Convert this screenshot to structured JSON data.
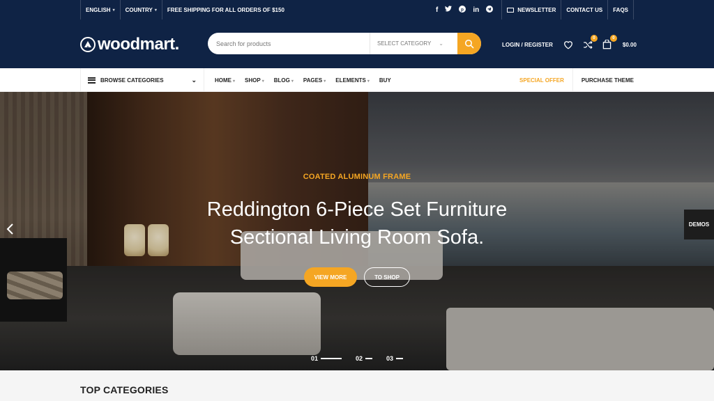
{
  "topbar": {
    "language": "ENGLISH",
    "country": "COUNTRY",
    "shipping": "FREE SHIPPING FOR ALL ORDERS OF $150",
    "socials": [
      "f",
      "t",
      "p",
      "in",
      "tg"
    ],
    "newsletter": "NEWSLETTER",
    "contact": "CONTACT US",
    "faqs": "FAQS"
  },
  "header": {
    "logo": "woodmart.",
    "search_placeholder": "Search for products",
    "select_category": "SELECT CATEGORY",
    "login": "LOGIN / REGISTER",
    "compare_count": "0",
    "cart_count": "0",
    "cart_total": "$0.00"
  },
  "nav": {
    "browse": "BROWSE CATEGORIES",
    "items": [
      "HOME",
      "SHOP",
      "BLOG",
      "PAGES",
      "ELEMENTS",
      "BUY"
    ],
    "special": "SPECIAL OFFER",
    "purchase": "PURCHASE THEME"
  },
  "hero": {
    "subtitle": "COATED ALUMINUM FRAME",
    "title_line1": "Reddington 6-Piece Set Furniture",
    "title_line2": "Sectional Living Room Sofa.",
    "view_more": "VIEW MORE",
    "to_shop": "TO SHOP",
    "demos": "DEMOS",
    "slides": [
      "01",
      "02",
      "03"
    ],
    "active_slide": 0
  },
  "section": {
    "top_categories": "TOP CATEGORIES"
  },
  "colors": {
    "navy": "#0f2345",
    "accent": "#f5a623"
  }
}
